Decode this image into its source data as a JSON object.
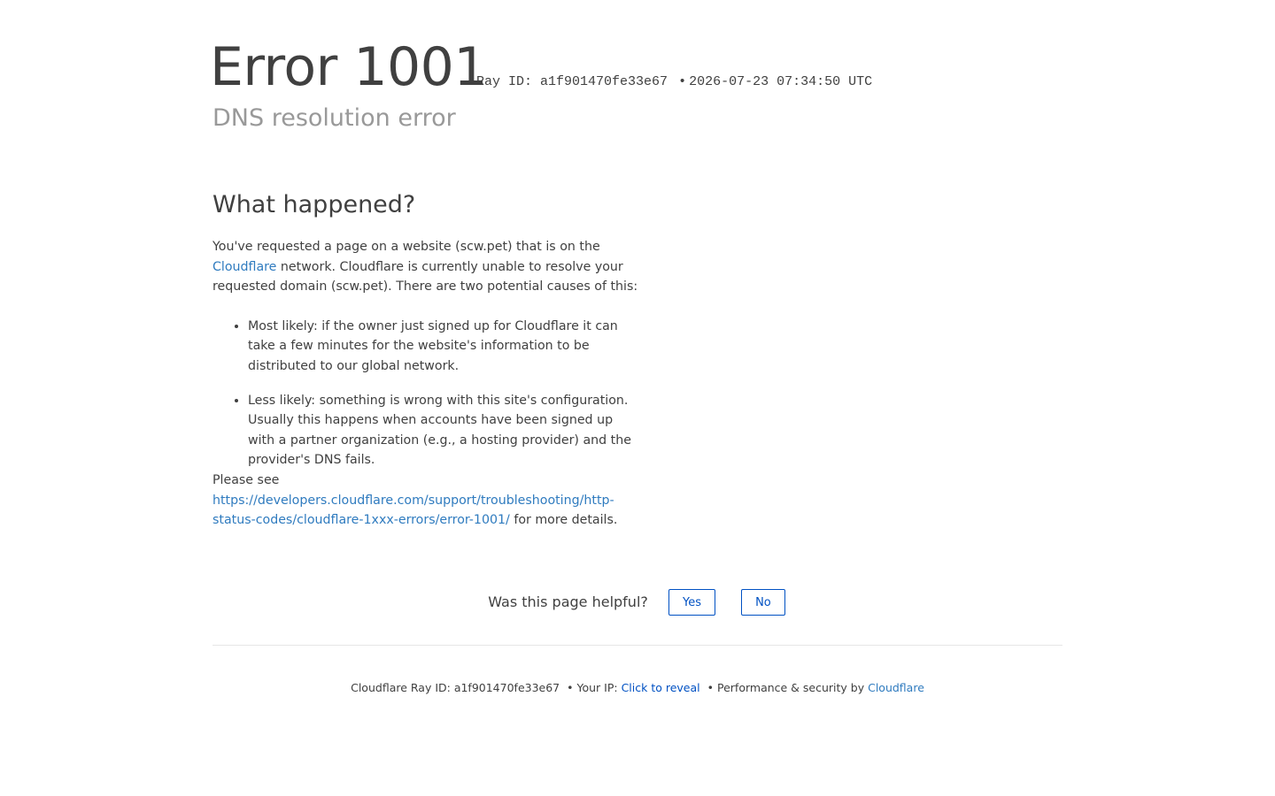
{
  "header": {
    "title": "Error 1001",
    "ray_label": "Ray ID: a1f901470fe33e67",
    "bullet": "•",
    "timestamp": "2026-07-23 07:34:50 UTC",
    "subtitle": "DNS resolution error"
  },
  "main": {
    "heading": "What happened?",
    "intro_before_link": "You've requested a page on a website (scw.pet) that is on the ",
    "intro_link": "Cloudflare",
    "intro_after_link": " network. Cloudflare is currently unable to resolve your requested domain (scw.pet). There are two potential causes of this:",
    "causes": [
      "Most likely: if the owner just signed up for Cloudflare it can take a few minutes for the website's information to be distributed to our global network.",
      "Less likely: something is wrong with this site's configuration. Usually this happens when accounts have been signed up with a partner organization (e.g., a hosting provider) and the provider's DNS fails."
    ],
    "see_prefix": "Please see",
    "see_link": "https://developers.cloudflare.com/support/troubleshooting/http-status-codes/cloudflare-1xxx-errors/error-1001/",
    "see_suffix": " for more details."
  },
  "feedback": {
    "question": "Was this page helpful?",
    "yes": "Yes",
    "no": "No"
  },
  "footer": {
    "ray": "Cloudflare Ray ID: a1f901470fe33e67",
    "bullet": "•",
    "ip_label": "Your IP: ",
    "ip_reveal": "Click to reveal",
    "perf": "Performance & security by ",
    "brand": "Cloudflare"
  },
  "colors": {
    "text": "#404040",
    "muted": "#999999",
    "link": "#2f7bbf",
    "button": "#0051c3"
  }
}
